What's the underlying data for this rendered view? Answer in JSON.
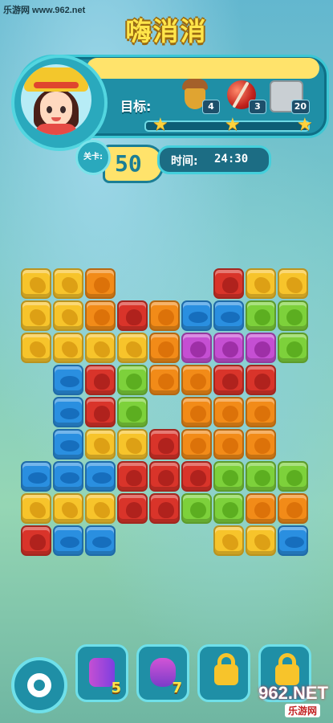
{
  "watermark_top": "乐游网 www.962.net",
  "title": "嗨消消",
  "goal": {
    "label": "目标:",
    "items": [
      {
        "icon": "acorn-icon",
        "count": "4"
      },
      {
        "icon": "red-ball-icon",
        "count": "3"
      },
      {
        "icon": "stone-block-icon",
        "count": "20"
      }
    ],
    "progress": 0.0
  },
  "level": {
    "badge": "关卡:",
    "value": "50"
  },
  "time": {
    "label": "时间:",
    "value": "24:30"
  },
  "board": [
    [
      "yellow",
      "yellow",
      "orange",
      null,
      null,
      null,
      "red",
      "yellow",
      "yellow"
    ],
    [
      "yellow",
      "yellow",
      "orange",
      "red",
      "orange",
      "blue",
      "blue",
      "green",
      "green"
    ],
    [
      "yellow",
      "yellow",
      "yellow",
      "yellow",
      "orange",
      "purple",
      "purple",
      "purple",
      "green"
    ],
    [
      null,
      "blue",
      "red",
      "green",
      "orange",
      "orange",
      "red",
      "red",
      null
    ],
    [
      null,
      "blue",
      "red",
      "green",
      null,
      "orange",
      "orange",
      "orange",
      null
    ],
    [
      null,
      "blue",
      "yellow",
      "yellow",
      "red",
      "orange",
      "orange",
      "orange",
      null
    ],
    [
      "blue",
      "blue",
      "blue",
      "red",
      "red",
      "red",
      "green",
      "green",
      "green"
    ],
    [
      "yellow",
      "yellow",
      "yellow",
      "red",
      "red",
      "green",
      "green",
      "orange",
      "orange"
    ],
    [
      "red",
      "blue",
      "blue",
      null,
      null,
      null,
      "yellow",
      "yellow",
      "blue"
    ]
  ],
  "tools": [
    {
      "icon": "swap-hammer-icon",
      "count": "5",
      "locked": false
    },
    {
      "icon": "refresh-capsule-icon",
      "count": "7",
      "locked": false
    },
    {
      "icon": "lock-icon",
      "count": "",
      "locked": true
    },
    {
      "icon": "lock-icon",
      "count": "",
      "locked": true
    }
  ],
  "watermark_bottom": {
    "main": "962.NET",
    "sub": "乐游网"
  }
}
